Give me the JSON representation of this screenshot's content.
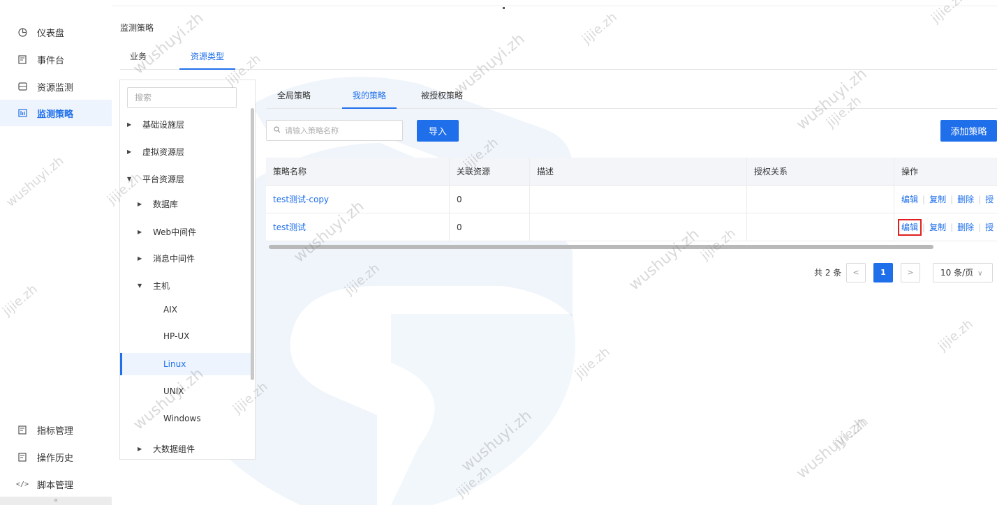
{
  "nav": {
    "items": [
      {
        "label": "仪表盘",
        "icon": "dashboard-icon"
      },
      {
        "label": "事件台",
        "icon": "event-icon"
      },
      {
        "label": "资源监测",
        "icon": "monitor-icon"
      },
      {
        "label": "监测策略",
        "icon": "policy-icon",
        "active": true
      },
      {
        "label": "指标管理",
        "icon": "metric-icon"
      },
      {
        "label": "操作历史",
        "icon": "history-icon"
      },
      {
        "label": "脚本管理",
        "icon": "code-icon"
      }
    ],
    "collapse": "«"
  },
  "breadcrumb": "监测策略",
  "top_tabs": [
    {
      "label": "业务"
    },
    {
      "label": "资源类型",
      "active": true
    }
  ],
  "tree": {
    "search_placeholder": "搜索",
    "nodes": [
      {
        "label": "基础设施层",
        "caret": "▶"
      },
      {
        "label": "虚拟资源层",
        "caret": "▶"
      },
      {
        "label": "平台资源层",
        "caret": "▼"
      },
      {
        "label": "数据库",
        "caret": "▶"
      },
      {
        "label": "Web中间件",
        "caret": "▶"
      },
      {
        "label": "消息中间件",
        "caret": "▶"
      },
      {
        "label": "主机",
        "caret": "▼"
      },
      {
        "label": "AIX"
      },
      {
        "label": "HP-UX"
      },
      {
        "label": "Linux",
        "selected": true
      },
      {
        "label": "UNIX"
      },
      {
        "label": "Windows"
      },
      {
        "label": "大数据组件",
        "caret": "▶"
      }
    ]
  },
  "sub_tabs": [
    {
      "label": "全局策略"
    },
    {
      "label": "我的策略",
      "active": true
    },
    {
      "label": "被授权策略"
    }
  ],
  "toolbar": {
    "search_placeholder": "请输入策略名称",
    "import_label": "导入",
    "add_label": "添加策略"
  },
  "table": {
    "columns": [
      "策略名称",
      "关联资源",
      "描述",
      "授权关系",
      "操作"
    ],
    "rows": [
      {
        "name": "test测试-copy",
        "resources": "0",
        "desc": "",
        "auth": ""
      },
      {
        "name": "test测试",
        "resources": "0",
        "desc": "",
        "auth": ""
      }
    ],
    "ops": [
      "编辑",
      "复制",
      "删除",
      "授"
    ]
  },
  "pagination": {
    "total": "共 2 条",
    "prev": "<",
    "current": "1",
    "next": ">",
    "page_size": "10 条/页",
    "chevron": "∨"
  },
  "watermarks": [
    "wushuyi.zh",
    "jijie.zh"
  ],
  "colors": {
    "accent": "#1f6feb",
    "highlight": "#e02020",
    "logo": "#2a78c8"
  }
}
